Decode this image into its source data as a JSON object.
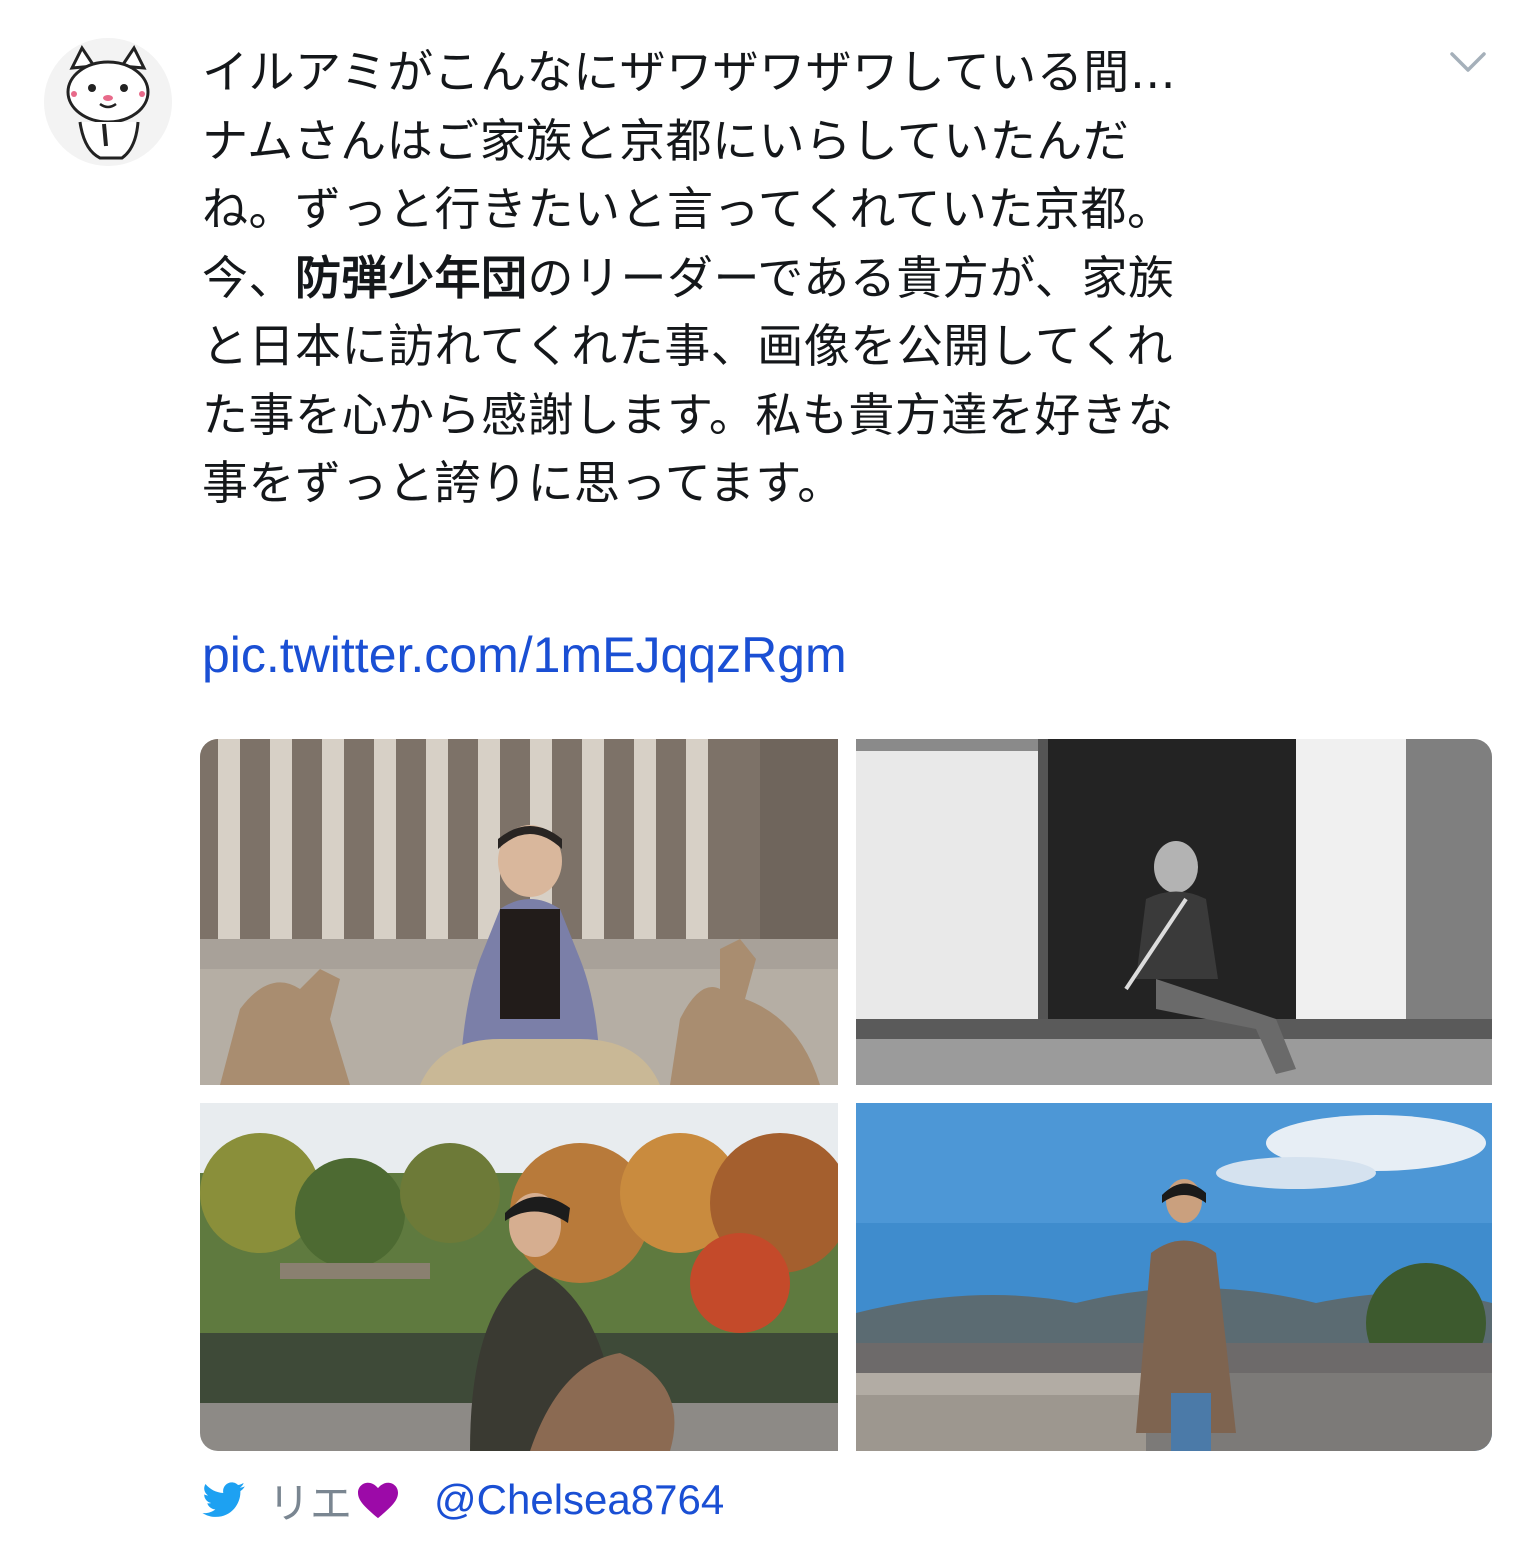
{
  "tweet": {
    "text_lines": [
      "イルアミがこんなにザワザワザワしている間…",
      "ナムさんはご家族と京都にいらしていたんだ",
      "ね。ずっと行きたいと言ってくれていた京都。"
    ],
    "line4_prefix": "今、",
    "line4_bold": "防弾少年団",
    "line4_suffix": "のリーダーである貴方が、家族",
    "text_lines_rest": [
      "と日本に訪れてくれた事、画像を公開してくれ",
      "た事を心から感謝します。私も貴方達を好きな",
      "事をずっと誇りに思ってます。"
    ],
    "link": "pic.twitter.com/1mEJqqzRgm"
  },
  "author": {
    "display_name": "リエ",
    "handle": "@Chelsea8764"
  },
  "icons": {
    "avatar": "cat-avatar-icon",
    "caret": "chevron-down-icon",
    "bird": "twitter-bird-icon",
    "heart": "purple-heart-icon"
  },
  "colors": {
    "link": "#1a4fd4",
    "twitter_blue": "#1da1f2",
    "heart": "#9c0aa8",
    "muted": "#7a8691"
  }
}
